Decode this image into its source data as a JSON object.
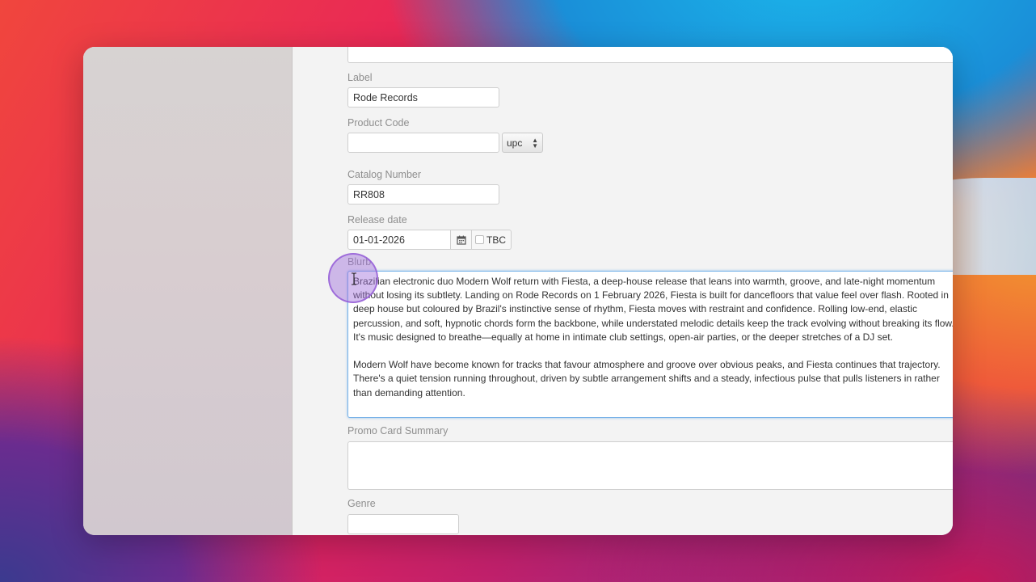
{
  "form": {
    "label": {
      "title": "Label",
      "value": "Rode Records"
    },
    "product_code": {
      "title": "Product Code",
      "value": "",
      "type_selected": "upc"
    },
    "catalog_number": {
      "title": "Catalog Number",
      "value": "RR808"
    },
    "release_date": {
      "title": "Release date",
      "value": "01-01-2026",
      "tbc_label": "TBC"
    },
    "blurb": {
      "title": "Blurb",
      "paragraph1": "Brazilian electronic duo Modern Wolf return with Fiesta, a deep-house release that leans into warmth, groove, and late-night momentum without losing its subtlety. Landing on Rode Records on 1 February 2026, Fiesta is built for dancefloors that value feel over flash. Rooted in deep house but coloured by Brazil's instinctive sense of rhythm, Fiesta moves with restraint and confidence. Rolling low-end, elastic percussion, and soft, hypnotic chords form the backbone, while understated melodic details keep the track evolving without breaking its flow. It's music designed to breathe—equally at home in intimate club settings, open-air parties, or the deeper stretches of a DJ set.",
      "paragraph2": "Modern Wolf have become known for tracks that favour atmosphere and groove over obvious peaks, and Fiesta continues that trajectory. There's a quiet tension running throughout, driven by subtle arrangement shifts and a steady, infectious pulse that pulls listeners in rather than demanding attention."
    },
    "promo_card_summary": {
      "title": "Promo Card Summary",
      "value": ""
    },
    "genre": {
      "title": "Genre",
      "value": ""
    }
  },
  "colors": {
    "focus_border": "#79b3e8",
    "cursor_highlight": "#a06edc"
  }
}
